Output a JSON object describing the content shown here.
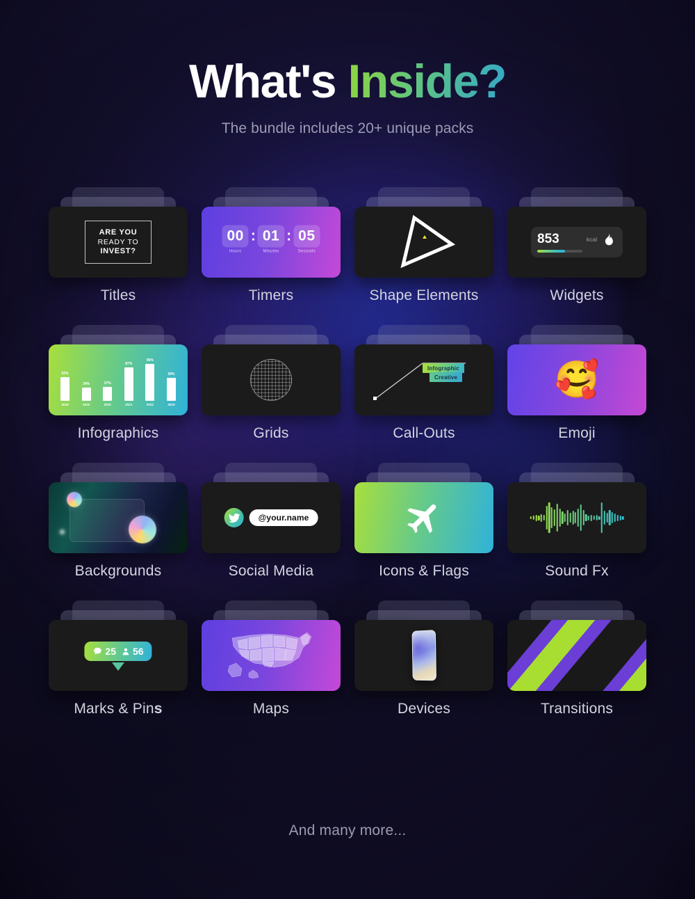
{
  "header": {
    "title_white": "What's",
    "title_gradient": "Inside?",
    "subtitle": "The bundle includes 20+ unique packs"
  },
  "footer": {
    "text": "And many more..."
  },
  "colors": {
    "background": "#110f26",
    "glow_blue": "#2e40dc",
    "accent_green": "#a8df3c",
    "accent_cyan": "#30b2da",
    "accent_purple": "#6b3ed6",
    "accent_magenta": "#c549d8",
    "card_dark": "#1b1b1b",
    "label_text": "#dcdce8",
    "muted_text": "#9b9bb4"
  },
  "packs": [
    {
      "label": "Titles",
      "icon": "title-frame-icon",
      "face": "f-dark",
      "content": {
        "line1": "ARE YOU",
        "line2": "READY TO",
        "line3": "INVEST?"
      }
    },
    {
      "label": "Timers",
      "icon": "countdown-timer-icon",
      "face": "f-timer",
      "content": {
        "hours": "00",
        "minutes": "01",
        "seconds": "05",
        "hours_label": "Hours",
        "minutes_label": "Minutes",
        "seconds_label": "Seconds",
        "separator": ":"
      }
    },
    {
      "label": "Shape Elements",
      "icon": "triangle-shape-icon",
      "face": "f-dark",
      "content": {}
    },
    {
      "label": "Widgets",
      "icon": "calorie-widget-icon",
      "face": "f-dark",
      "content": {
        "value": "853",
        "unit": "kcal",
        "progress_pct": 62
      }
    },
    {
      "label": "Infographics",
      "icon": "bar-chart-icon",
      "face": "f-greencyan",
      "content": {}
    },
    {
      "label": "Grids",
      "icon": "grid-sphere-icon",
      "face": "f-dark",
      "content": {}
    },
    {
      "label": "Call-Outs",
      "icon": "callout-line-icon",
      "face": "f-dark",
      "content": {
        "tag1": "Infographic",
        "tag2": "Creative"
      }
    },
    {
      "label": "Emoji",
      "icon": "smiling-face-with-hearts-icon",
      "face": "f-purple",
      "content": {
        "glyph": "🥰"
      }
    },
    {
      "label": "Backgrounds",
      "icon": "gradient-orbs-icon",
      "face": "f-bgpack",
      "content": {}
    },
    {
      "label": "Social Media",
      "icon": "twitter-bird-icon",
      "face": "f-dark",
      "content": {
        "handle": "@your.name"
      }
    },
    {
      "label": "Icons & Flags",
      "icon": "airplane-icon",
      "face": "f-greencyan",
      "content": {}
    },
    {
      "label": "Sound Fx",
      "icon": "audio-waveform-icon",
      "face": "f-dark",
      "content": {}
    },
    {
      "label": "Marks & Pins",
      "label_plain": "Marks & Pin",
      "label_bold": "s",
      "icon": "map-pin-stats-icon",
      "face": "f-dark",
      "content": {
        "comments": "25",
        "people": "56"
      }
    },
    {
      "label": "Maps",
      "icon": "usa-map-icon",
      "face": "f-timer",
      "content": {}
    },
    {
      "label": "Devices",
      "icon": "smartphone-mockup-icon",
      "face": "f-dark",
      "content": {}
    },
    {
      "label": "Transitions",
      "icon": "diagonal-stripes-icon",
      "face": "f-dark",
      "content": {}
    }
  ],
  "chart_data": {
    "type": "bar",
    "title": "",
    "categories": [
      "2018",
      "2019",
      "2020",
      "2021",
      "2022",
      "2023"
    ],
    "values": [
      62,
      34,
      37,
      87,
      96,
      59
    ],
    "value_labels": [
      "62%",
      "34%",
      "37%",
      "87%",
      "96%",
      "59%"
    ],
    "xlabel": "",
    "ylabel": "",
    "ylim": [
      0,
      100
    ],
    "grid": false,
    "legend": false,
    "series_color": "#ffffff",
    "plot_background": "linear-gradient green to cyan"
  }
}
